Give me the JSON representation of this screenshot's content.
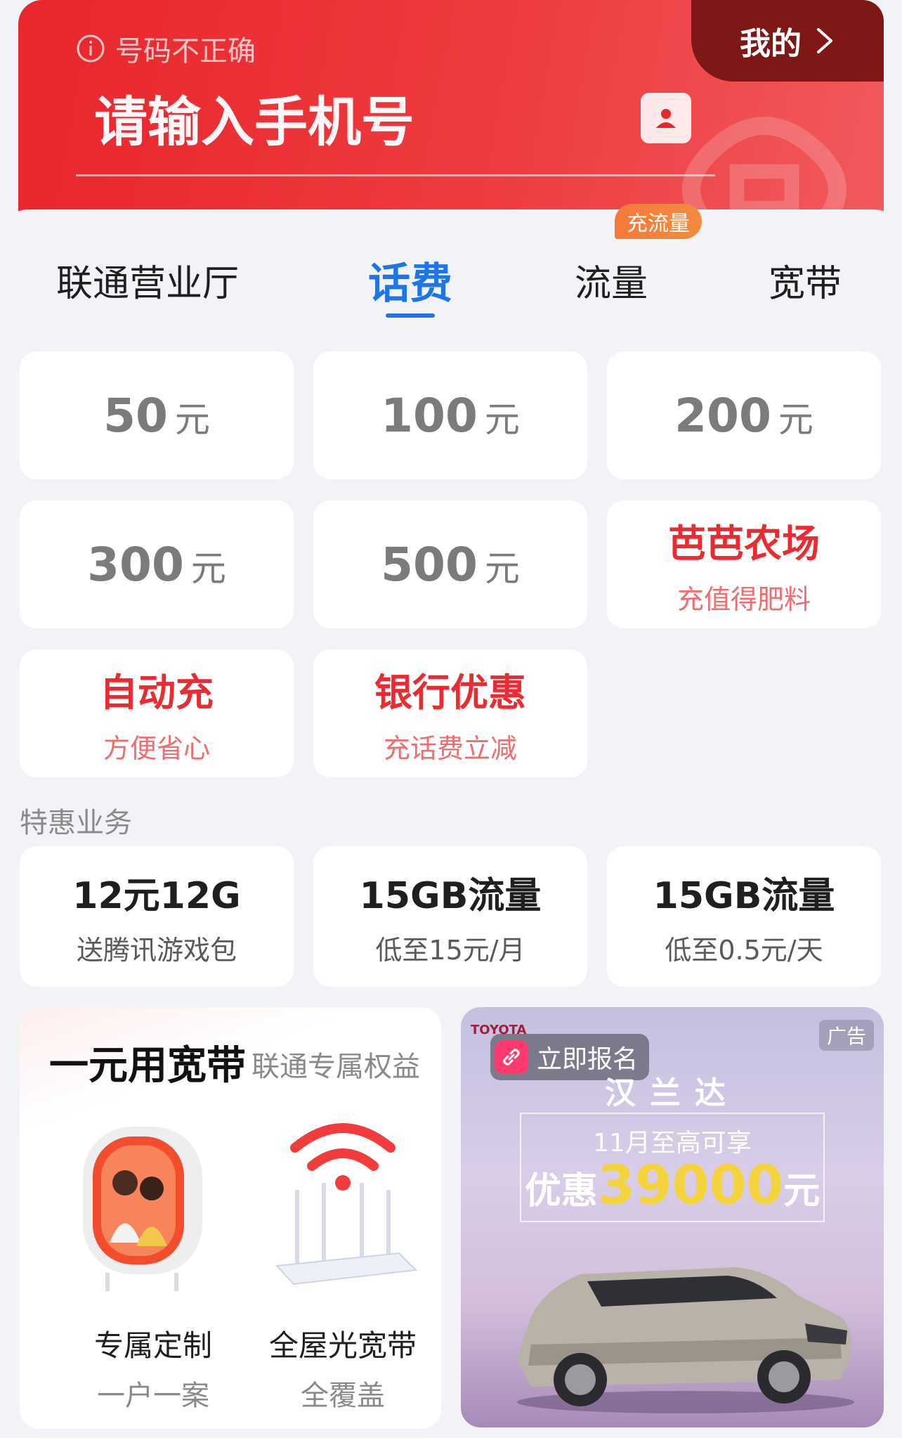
{
  "header": {
    "error_text": "号码不正确",
    "phone_placeholder": "请输入手机号",
    "mine_label": "我的"
  },
  "tabs": [
    {
      "label": "联通营业厅"
    },
    {
      "label": "话费",
      "active": true
    },
    {
      "label": "流量",
      "badge": "充流量"
    },
    {
      "label": "宽带"
    }
  ],
  "recharge_amounts": [
    {
      "value": "50",
      "unit": "元"
    },
    {
      "value": "100",
      "unit": "元"
    },
    {
      "value": "200",
      "unit": "元"
    },
    {
      "value": "300",
      "unit": "元"
    },
    {
      "value": "500",
      "unit": "元"
    }
  ],
  "promo_cards": [
    {
      "title": "芭芭农场",
      "subtitle": "充值得肥料"
    },
    {
      "title": "自动充",
      "subtitle": "方便省心"
    },
    {
      "title": "银行优惠",
      "subtitle": "充话费立减"
    }
  ],
  "special_section": {
    "label": "特惠业务",
    "items": [
      {
        "title": "12元12G",
        "subtitle": "送腾讯游戏包"
      },
      {
        "title": "15GB流量",
        "subtitle": "低至15元/月"
      },
      {
        "title": "15GB流量",
        "subtitle": "低至0.5元/天"
      }
    ]
  },
  "broadband": {
    "title": "一元用宽带",
    "subtitle": "联通专属权益",
    "items": [
      {
        "title": "专属定制",
        "subtitle": "一户一案"
      },
      {
        "title": "全屋光宽带",
        "subtitle": "全覆盖"
      }
    ]
  },
  "ad": {
    "brand": "TOYOTA",
    "signup_label": "立即报名",
    "ad_tag": "广告",
    "model": "汉兰达",
    "line1": "11月至高可享",
    "line2_prefix": "优惠",
    "line2_amount": "39000",
    "line2_suffix": "元"
  },
  "colors": {
    "brand_red": "#e8262d",
    "active_tab_blue": "#1f74e6",
    "promo_red": "#ea2b31",
    "badge_orange": "#f6783a",
    "ad_highlight": "#f3d43d"
  }
}
